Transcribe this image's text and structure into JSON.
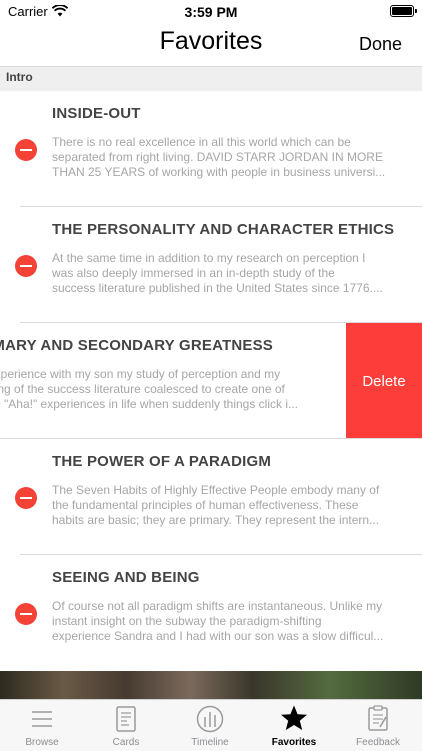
{
  "status_bar": {
    "carrier": "Carrier",
    "time": "3:59 PM"
  },
  "nav": {
    "title": "Favorites",
    "done_label": "Done"
  },
  "section": {
    "header": "Intro"
  },
  "items": [
    {
      "title": "INSIDE-OUT",
      "lines": [
        "There is no real excellence in all this world which can be",
        "separated from right living. DAVID STARR JORDAN IN MORE",
        "THAN 25 YEARS of working with people in business universi..."
      ]
    },
    {
      "title": "THE PERSONALITY AND CHARACTER ETHICS",
      "lines": [
        "At the same time in addition to my research on perception I",
        "was also deeply immersed in an in-depth study of the",
        "success literature published in the United States since 1776...."
      ]
    },
    {
      "title": "IMARY AND SECONDARY GREATNESS",
      "lines": [
        "experience with my son my study of perception and my",
        "ding of the success literature coalesced to create one of",
        "se \"Aha!\" experiences in life when suddenly things click i..."
      ],
      "delete_label": "Delete"
    },
    {
      "title": "THE POWER OF A PARADIGM",
      "lines": [
        "The Seven Habits of Highly Effective People embody many of",
        "the fundamental principles of human effectiveness. These",
        "habits are basic; they are primary. They represent the intern..."
      ]
    },
    {
      "title": "SEEING AND BEING",
      "lines": [
        "Of course not all paradigm shifts are instantaneous. Unlike my",
        "instant insight on the subway the paradigm-shifting",
        "experience Sandra and I had with our son was a slow difficul..."
      ]
    }
  ],
  "tabs": [
    {
      "label": "Browse",
      "icon": "list-icon"
    },
    {
      "label": "Cards",
      "icon": "cards-icon"
    },
    {
      "label": "Timeline",
      "icon": "timeline-icon"
    },
    {
      "label": "Favorites",
      "icon": "star-icon",
      "active": true
    },
    {
      "label": "Feedback",
      "icon": "clipboard-icon"
    }
  ],
  "colors": {
    "delete_red": "#fc3d39",
    "minus_red": "#f44336"
  }
}
